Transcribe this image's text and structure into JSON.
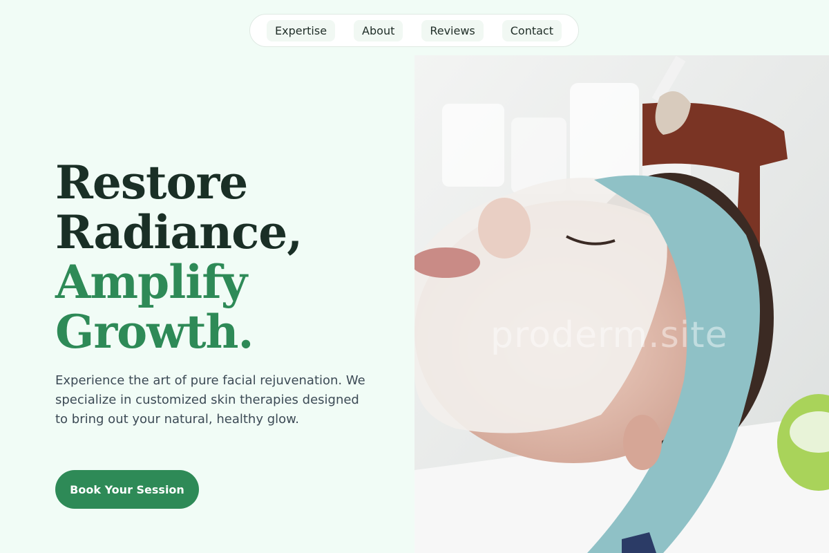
{
  "nav": {
    "items": [
      {
        "label": "Expertise"
      },
      {
        "label": "About"
      },
      {
        "label": "Reviews"
      },
      {
        "label": "Contact"
      }
    ]
  },
  "hero": {
    "headline_line1": "Restore",
    "headline_line2": "Radiance,",
    "headline_line3": "Amplify",
    "headline_line4": "Growth.",
    "description": "Experience the art of pure facial rejuvenation. We specialize in customized skin therapies designed to bring out your natural, healthy glow.",
    "cta_label": "Book Your Session",
    "image_watermark": "proderm.site"
  },
  "colors": {
    "background": "#f1fcf6",
    "brand_green": "#2e8a57",
    "headline_dark": "#1a2f26"
  }
}
